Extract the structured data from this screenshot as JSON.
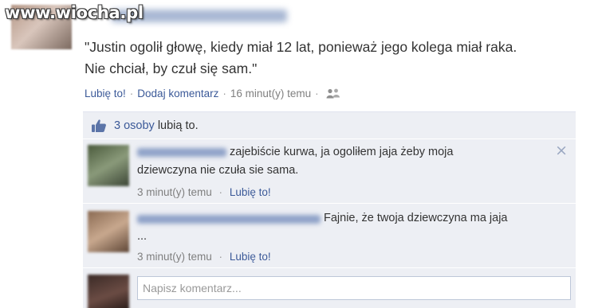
{
  "watermark": "www.wiocha.pl",
  "post": {
    "text_line1": "\"Justin ogolił głowę, kiedy miał 12 lat, ponieważ jego kolega miał raka.",
    "text_line2": "Nie chciał, by czuł się sam.\"",
    "like_label": "Lubię to!",
    "comment_label": "Dodaj komentarz",
    "time": "16 minut(y) temu",
    "separator": "·"
  },
  "likes": {
    "count_link": "3 osoby",
    "suffix": " lubią to."
  },
  "comments": [
    {
      "text_line1": "zajebiście kurwa, ja ogoliłem jaja żeby moja",
      "text_line2": "dziewczyna nie czuła sie sama.",
      "time": "3 minut(y) temu",
      "like_label": "Lubię to!",
      "close": "×"
    },
    {
      "text_line1": "Fajnie, że twoja dziewczyna ma jaja",
      "text_line2": "...",
      "time": "3 minut(y) temu",
      "like_label": "Lubię to!"
    }
  ],
  "compose": {
    "placeholder": "Napisz komentarz..."
  },
  "colors": {
    "link": "#3b5998",
    "comments_bg": "#edeff4",
    "meta": "#7f7f7f"
  }
}
